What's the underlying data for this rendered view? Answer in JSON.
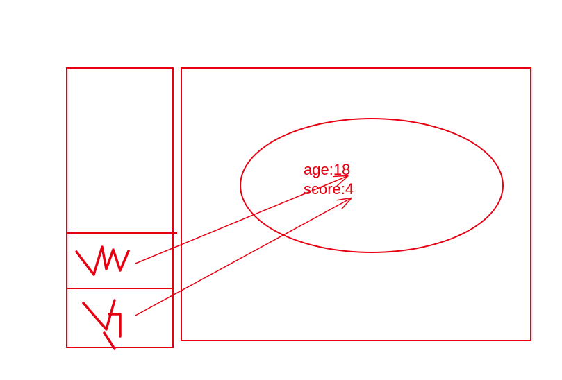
{
  "diagram": {
    "stroke_color": "#e60012",
    "fields": {
      "age_label": "age:18",
      "score_label": "score:4"
    },
    "handwritten": {
      "mark1": "tm",
      "mark2": "th"
    }
  }
}
